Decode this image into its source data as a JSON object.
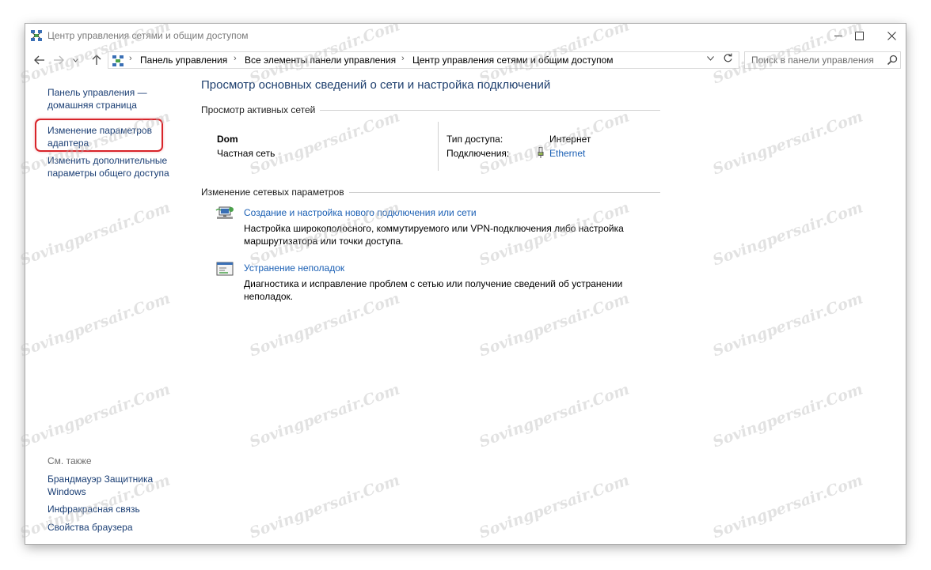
{
  "window": {
    "title": "Центр управления сетями и общим доступом"
  },
  "address_bar": {
    "crumbs": [
      "Панель управления",
      "Все элементы панели управления",
      "Центр управления сетями и общим доступом"
    ],
    "search_placeholder": "Поиск в панели управления"
  },
  "left_pane": {
    "home_link": "Панель управления — домашняя страница",
    "adapter_link": "Изменение параметров адаптера",
    "sharing_link": "Изменить дополнительные параметры общего доступа",
    "see_also_heading": "См. также",
    "see_also": [
      "Брандмауэр Защитника Windows",
      "Инфракрасная связь",
      "Свойства браузера"
    ]
  },
  "main": {
    "title": "Просмотр основных сведений о сети и настройка подключений",
    "active_networks_heading": "Просмотр активных сетей",
    "network": {
      "name": "Dom",
      "type": "Частная сеть",
      "access_label": "Тип доступа:",
      "access_value": "Интернет",
      "connections_label": "Подключения:",
      "connections_value": "Ethernet"
    },
    "change_settings_heading": "Изменение сетевых параметров",
    "tasks": [
      {
        "link": "Создание и настройка нового подключения или сети",
        "description": "Настройка широкополосного, коммутируемого или VPN-подключения либо настройка маршрутизатора или точки доступа.",
        "icon": "network-setup-icon"
      },
      {
        "link": "Устранение неполадок",
        "description": "Диагностика и исправление проблем с сетью или получение сведений об устранении неполадок.",
        "icon": "troubleshoot-icon"
      }
    ]
  },
  "watermark": {
    "text": "Sovingpersair.Com"
  },
  "colors": {
    "link": "#1a5fb4",
    "left_link": "#1a3e74",
    "highlight_border": "#d8242a"
  }
}
